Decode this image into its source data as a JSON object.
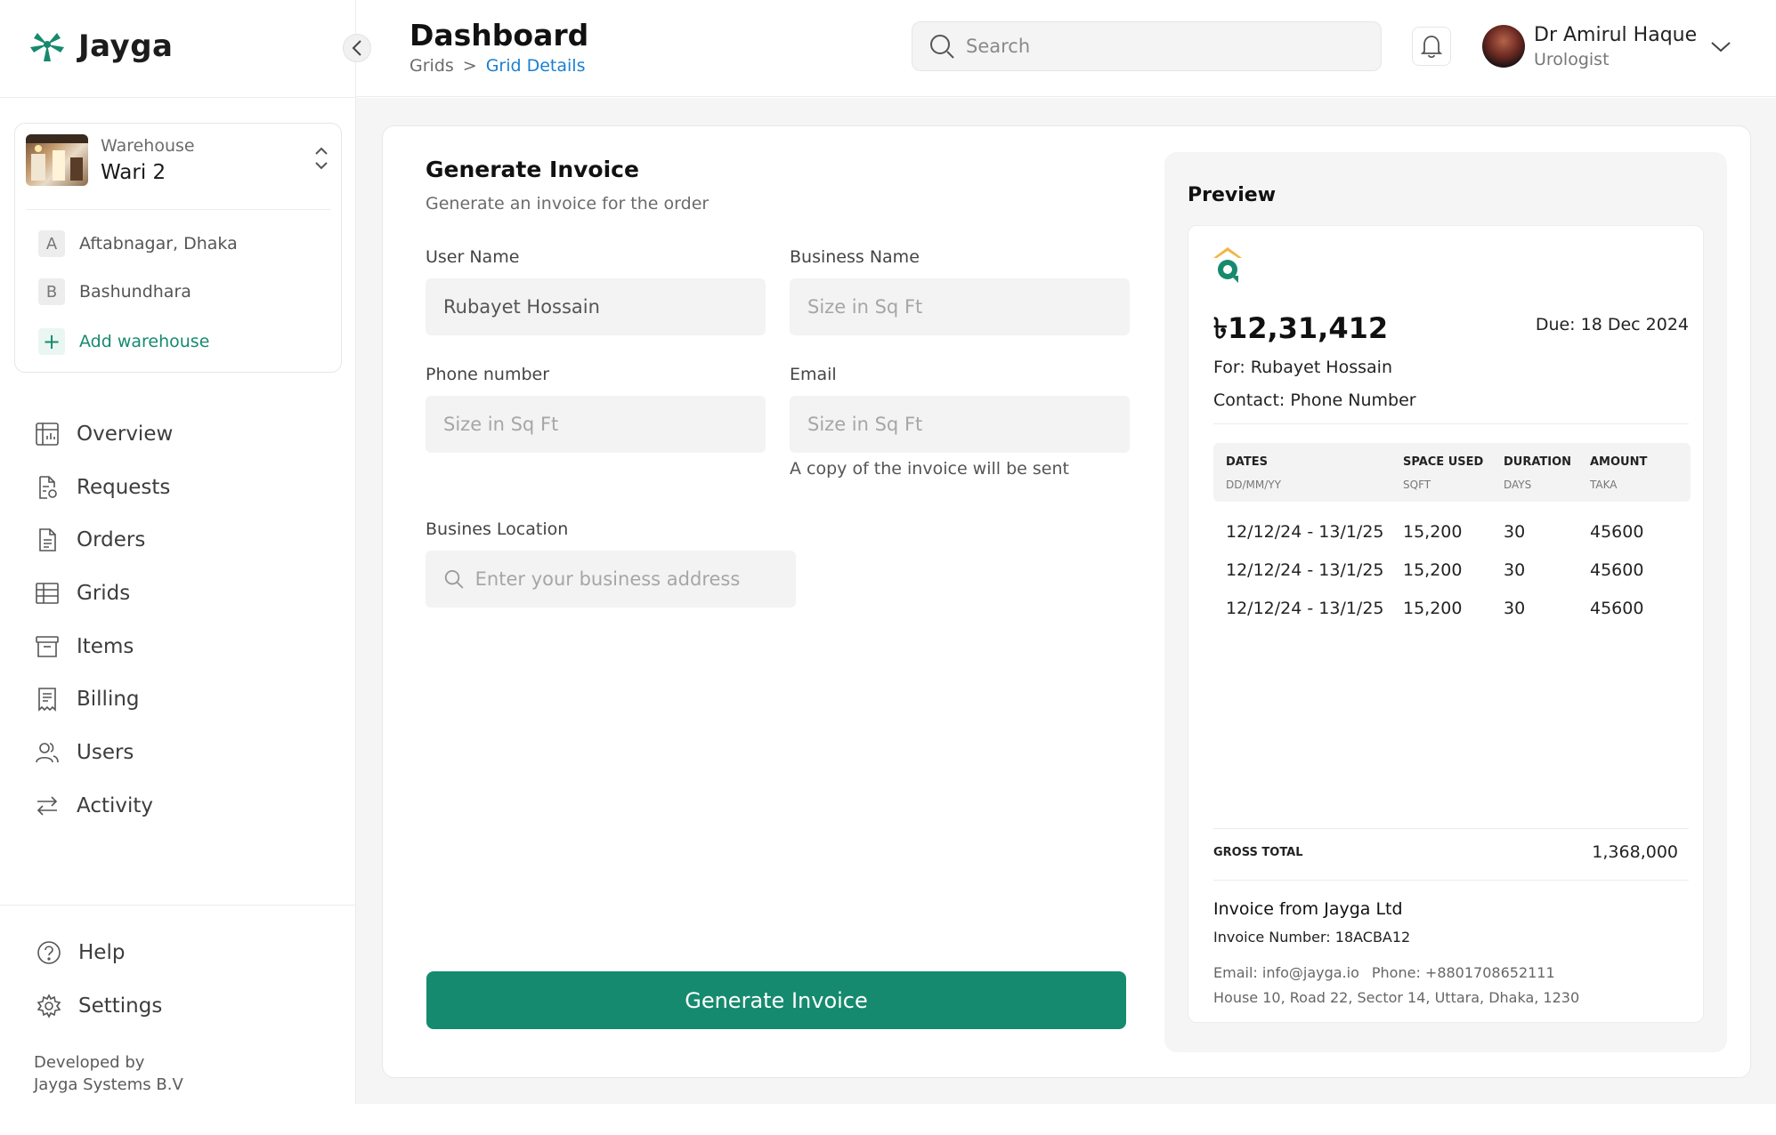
{
  "brand": {
    "name": "Jayga",
    "accent": "#168a6e",
    "link_color": "#1a7fd1"
  },
  "warehouse": {
    "label": "Warehouse",
    "current": "Wari 2",
    "list": [
      {
        "badge": "A",
        "name": "Aftabnagar, Dhaka"
      },
      {
        "badge": "B",
        "name": "Bashundhara"
      }
    ],
    "add_label": "Add warehouse"
  },
  "nav": [
    {
      "label": "Overview",
      "icon": "overview-icon"
    },
    {
      "label": "Requests",
      "icon": "requests-icon"
    },
    {
      "label": "Orders",
      "icon": "orders-icon"
    },
    {
      "label": "Grids",
      "icon": "grids-icon"
    },
    {
      "label": "Items",
      "icon": "items-icon"
    },
    {
      "label": "Billing",
      "icon": "billing-icon"
    },
    {
      "label": "Users",
      "icon": "users-icon"
    },
    {
      "label": "Activity",
      "icon": "activity-icon"
    }
  ],
  "bottom_nav": [
    {
      "label": "Help",
      "icon": "help-icon"
    },
    {
      "label": "Settings",
      "icon": "gear-icon"
    }
  ],
  "credit": {
    "line1": "Developed by",
    "line2": "Jayga Systems B.V"
  },
  "header": {
    "title": "Dashboard",
    "breadcrumb": [
      "Grids",
      "Grid Details"
    ],
    "breadcrumb_separator": ">",
    "search_placeholder": "Search",
    "user": {
      "name": "Dr Amirul Haque",
      "role": "Urologist"
    }
  },
  "form": {
    "title": "Generate Invoice",
    "subtitle": "Generate an invoice for the order",
    "user_name": {
      "label": "User Name",
      "value": "Rubayet Hossain"
    },
    "business_name": {
      "label": "Business Name",
      "placeholder": "Size in Sq Ft"
    },
    "phone": {
      "label": "Phone number",
      "placeholder": "Size in Sq Ft"
    },
    "email": {
      "label": "Email",
      "placeholder": "Size in Sq Ft",
      "hint": "A copy of the invoice will be sent"
    },
    "location": {
      "label": "Busines Location",
      "placeholder": "Enter your business address"
    },
    "submit_label": "Generate Invoice"
  },
  "preview": {
    "title": "Preview",
    "amount": "৳12,31,412",
    "due": "Due: 18 Dec 2024",
    "for": "For: Rubayet Hossain",
    "contact": "Contact: Phone Number",
    "columns": [
      {
        "title": "DATES",
        "sub": "DD/MM/YY"
      },
      {
        "title": "SPACE USED",
        "sub": "SQFT"
      },
      {
        "title": "DURATION",
        "sub": "DAYS"
      },
      {
        "title": "AMOUNT",
        "sub": "TAKA"
      }
    ],
    "rows": [
      {
        "dates": "12/12/24 - 13/1/25",
        "space": "15,200",
        "duration": "30",
        "amount": "45600"
      },
      {
        "dates": "12/12/24 - 13/1/25",
        "space": "15,200",
        "duration": "30",
        "amount": "45600"
      },
      {
        "dates": "12/12/24 - 13/1/25",
        "space": "15,200",
        "duration": "30",
        "amount": "45600"
      }
    ],
    "gross_label": "GROSS TOTAL",
    "gross_value": "1,368,000",
    "from": "Invoice from Jayga Ltd",
    "invoice_number": "Invoice Number: 18ACBA12",
    "email": "Email: info@jayga.io",
    "phone": "Phone: +8801708652111",
    "address": "House 10, Road 22, Sector 14, Uttara, Dhaka, 1230"
  }
}
